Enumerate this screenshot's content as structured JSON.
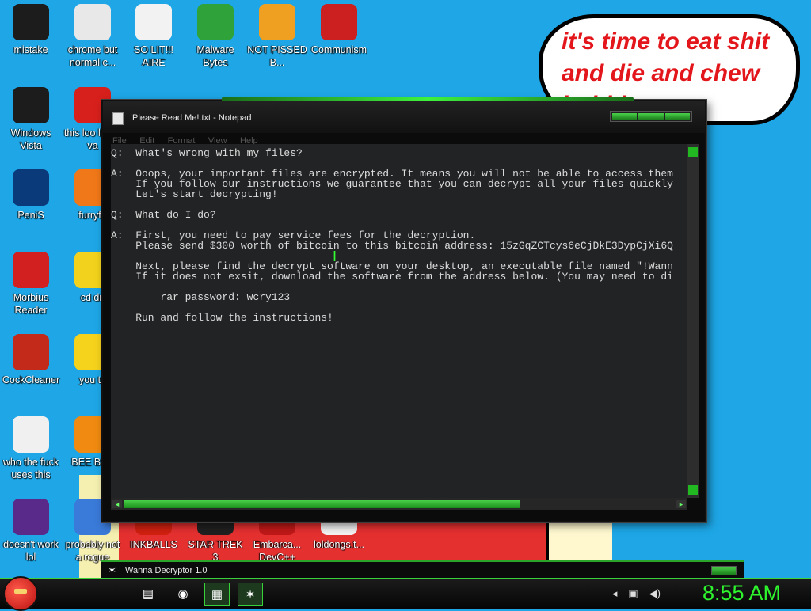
{
  "speech_bubble": {
    "lines": [
      "it's time to eat shit",
      "and die and chew",
      "bubble gum"
    ]
  },
  "desktop_icons": [
    {
      "label": "mistake",
      "icon": "green-circle-icon",
      "color": "#1c1c1c"
    },
    {
      "label": "chrome but normal c...",
      "icon": "chrome-icon",
      "color": "#e8e8e8"
    },
    {
      "label": "SO LIT!!! AIRE",
      "icon": "card-icon",
      "color": "#f2f2f2"
    },
    {
      "label": "Malware Bytes",
      "icon": "shield-icon",
      "color": "#2fa33a"
    },
    {
      "label": "NOT PISSED B...",
      "icon": "pig-icon",
      "color": "#f0a020"
    },
    {
      "label": "Communism",
      "icon": "flag-icon",
      "color": "#cc2020"
    },
    {
      "label": "Windows Vista",
      "icon": "recycle-icon",
      "color": "#1c1c1c"
    },
    {
      "label": "this loo like a va",
      "icon": "opera-icon",
      "color": "#d7201c"
    },
    {
      "label": "PeniS",
      "icon": "photoshop-icon",
      "color": "#0b3a7a"
    },
    {
      "label": "furryfo",
      "icon": "firefox-icon",
      "color": "#f07818"
    },
    {
      "label": "Morbius Reader",
      "icon": "pdf-icon",
      "color": "#d22020"
    },
    {
      "label": "cd dri",
      "icon": "cd-icon",
      "color": "#f2d21c"
    },
    {
      "label": "CockCleaner",
      "icon": "ccleaner-icon",
      "color": "#c42a1a"
    },
    {
      "label": "you tri",
      "icon": "star-icon",
      "color": "#f5d21c"
    },
    {
      "label": "who the fuck uses this",
      "icon": "lightning-icon",
      "color": "#f0f0f0"
    },
    {
      "label": "BEE BEE",
      "icon": "vlc-icon",
      "color": "#f08a10"
    },
    {
      "label": "doesn't work lol",
      "icon": "yahoo-icon",
      "color": "#5a2a8a"
    },
    {
      "label": "probably not a rogue",
      "icon": "monitor-icon",
      "color": "#3a7ad8"
    },
    {
      "label": "INKBALLS",
      "icon": "inkball-icon",
      "color": "#d02010"
    },
    {
      "label": "STAR TREK 3",
      "icon": "startrek-icon",
      "color": "#202020"
    },
    {
      "label": "Embarca... DevC++",
      "icon": "cpp-icon",
      "color": "#c01818"
    },
    {
      "label": "loldongs.t...",
      "icon": "document-icon",
      "color": "#f2f2f2"
    }
  ],
  "notepad": {
    "title": "!Please Read Me!.txt - Notepad",
    "menu": [
      "File",
      "Edit",
      "Format",
      "View",
      "Help"
    ],
    "lines": [
      "Q:  What's wrong with my files?",
      "",
      "A:  Ooops, your important files are encrypted. It means you will not be able to access them",
      "    If you follow our instructions we guarantee that you can decrypt all your files quickly",
      "    Let's start decrypting!",
      "",
      "Q:  What do I do?",
      "",
      "A:  First, you need to pay service fees for the decryption.",
      "    Please send $300 worth of bitcoin to this bitcoin address: 15zGqZCTcys6eCjDkE3DypCjXi6Q",
      "",
      "    Next, please find the decrypt software on your desktop, an executable file named \"!Wann",
      "    If it does not exsit, download the software from the address below. (You may need to di",
      "",
      "        rar password: wcry123",
      "",
      "    Run and follow the instructions!"
    ]
  },
  "second_window": {
    "title": "Wanna Decryptor 1.0"
  },
  "taskbar": {
    "items": [
      {
        "name": "explorer",
        "icon": "folder-icon"
      },
      {
        "name": "chrome",
        "icon": "chrome-icon"
      },
      {
        "name": "notepad",
        "icon": "notepad-icon"
      },
      {
        "name": "wanna-decryptor",
        "icon": "wand-icon"
      }
    ],
    "clock": "8:55 AM"
  }
}
